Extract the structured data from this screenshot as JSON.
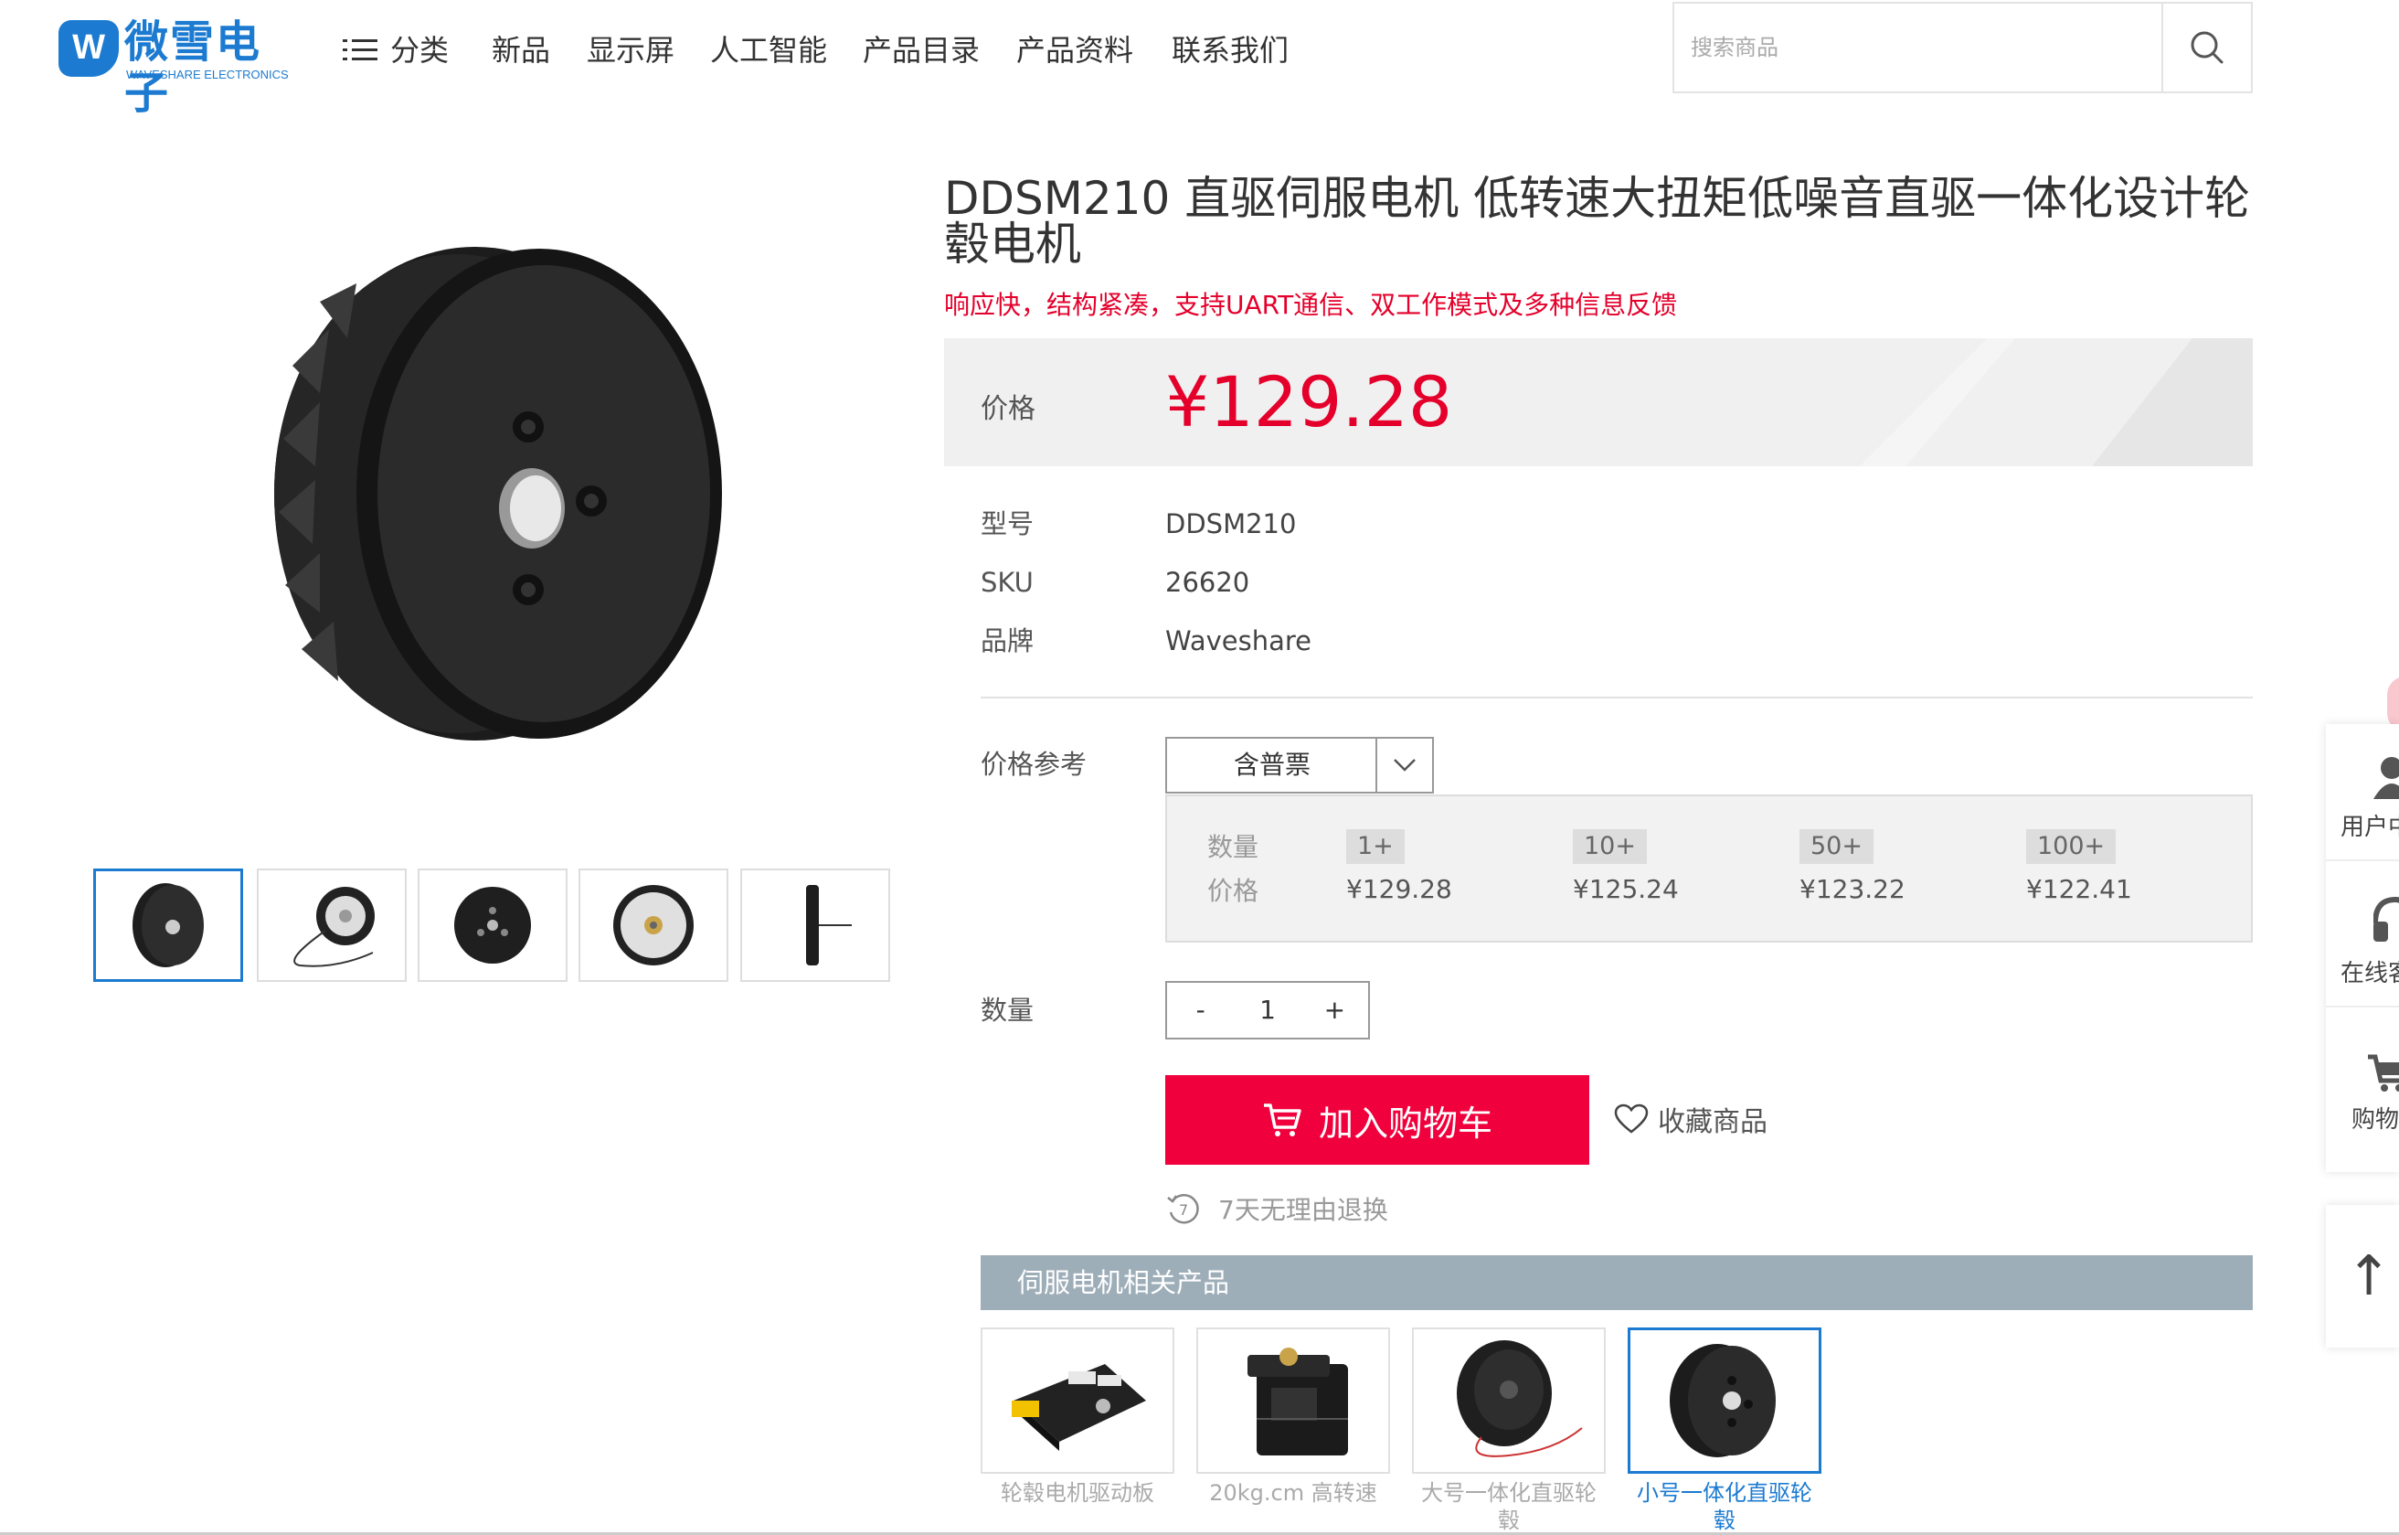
{
  "header": {
    "logo_cn": "微雪电子",
    "logo_en": "WAVESHARE ELECTRONICS",
    "nav": [
      "分类",
      "新品",
      "显示屏",
      "人工智能",
      "产品目录",
      "产品资料",
      "联系我们"
    ],
    "search_placeholder": "搜索商品"
  },
  "product": {
    "title": "DDSM210 直驱伺服电机 低转速大扭矩低噪音直驱一体化设计轮毂电机",
    "subtitle": "响应快，结构紧凑，支持UART通信、双工作模式及多种信息反馈",
    "price_label": "价格",
    "price": "¥129.28",
    "specs": [
      {
        "label": "型号",
        "value": "DDSM210"
      },
      {
        "label": "SKU",
        "value": "26620"
      },
      {
        "label": "品牌",
        "value": "Waveshare"
      }
    ],
    "price_ref_label": "价格参考",
    "invoice_option": "含普票",
    "tiers_qty_label": "数量",
    "tiers_price_label": "价格",
    "tiers": [
      {
        "qty": "1+",
        "price": "¥129.28"
      },
      {
        "qty": "10+",
        "price": "¥125.24"
      },
      {
        "qty": "50+",
        "price": "¥123.22"
      },
      {
        "qty": "100+",
        "price": "¥122.41"
      }
    ],
    "quantity_label": "数量",
    "quantity": {
      "minus": "-",
      "value": "1",
      "plus": "+"
    },
    "add_to_cart": "加入购物车",
    "favorite": "收藏商品",
    "returns": "7天无理由退换"
  },
  "related": {
    "title": "伺服电机相关产品",
    "items": [
      {
        "name": "轮毂电机驱动板"
      },
      {
        "name": "20kg.cm 高转速"
      },
      {
        "name": "大号一体化直驱轮毂"
      },
      {
        "name": "小号一体化直驱轮毂"
      }
    ]
  },
  "float_bar": {
    "items": [
      "用户中",
      "在线客",
      "购物"
    ],
    "top": "↑"
  },
  "colors": {
    "brand": "#1c7bd1",
    "price": "#e4002b",
    "cart": "#f0003c"
  }
}
